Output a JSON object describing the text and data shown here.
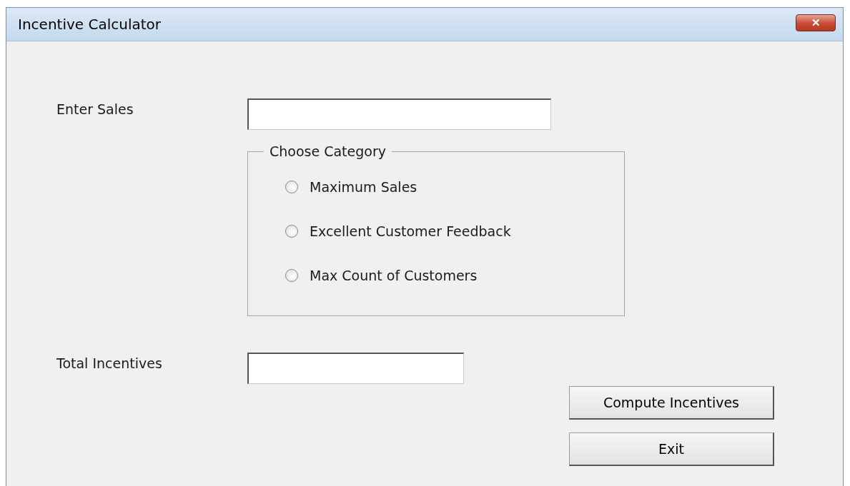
{
  "window": {
    "title": "Incentive Calculator",
    "close_label": "✕"
  },
  "sales": {
    "label": "Enter Sales"
  },
  "category": {
    "legend": "Choose Category",
    "options": [
      {
        "label": "Maximum Sales",
        "selected": false
      },
      {
        "label": "Excellent Customer Feedback",
        "selected": false
      },
      {
        "label": "Max Count of Customers",
        "selected": false
      }
    ]
  },
  "total": {
    "label": "Total Incentives"
  },
  "buttons": [
    {
      "label": "Compute Incentives"
    },
    {
      "label": "Exit"
    }
  ]
}
